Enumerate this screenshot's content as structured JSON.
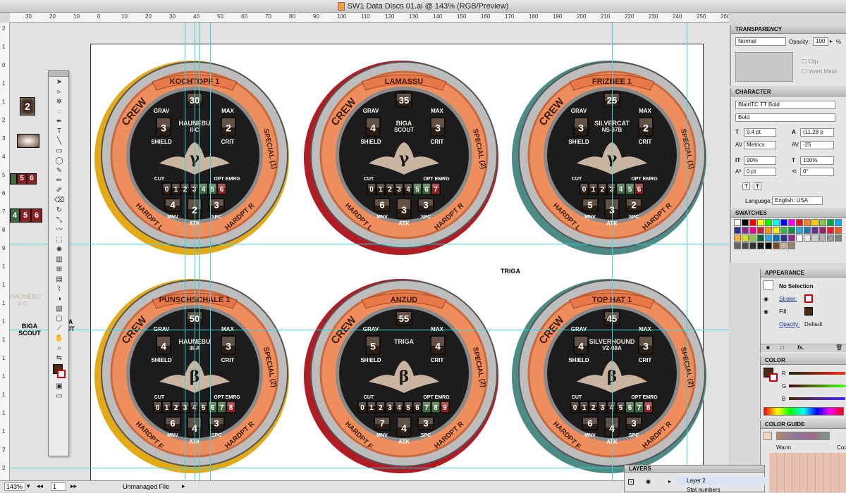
{
  "window": {
    "title": "SW1 Data Discs 01.ai @ 143% (RGB/Preview)"
  },
  "rulers": {
    "h_ticks": [
      "30",
      "20",
      "10",
      "0",
      "10",
      "20",
      "30",
      "40",
      "50",
      "60",
      "70",
      "80",
      "90",
      "100",
      "110",
      "120",
      "130",
      "140",
      "150",
      "160",
      "170",
      "180",
      "190",
      "200",
      "210",
      "220",
      "230",
      "240",
      "250",
      "260",
      "270",
      "280",
      "290",
      "300"
    ],
    "v_ticks": [
      "2",
      "1",
      "0",
      "1",
      "1",
      "2",
      "3",
      "4",
      "5",
      "6",
      "7",
      "8",
      "9",
      "1",
      "1",
      "1",
      "1",
      "1",
      "1",
      "1",
      "1",
      "1",
      "1",
      "2",
      "2"
    ]
  },
  "colors": {
    "yellow_rim": "#e3a917",
    "red_rim": "#b11b24",
    "teal_rim": "#4c8b86",
    "ring_orange": "#ef8e5c",
    "ring_orange_dark": "#c9693d",
    "face": "#1c1c1c",
    "ship": "#c9b49f",
    "guide": "#49d0d8",
    "cell_green": "#3f6a3f",
    "cell_red": "#8a2020"
  },
  "discs": [
    {
      "name": "KOCHTOPF 1",
      "points": "30",
      "grav": "3",
      "max": "2",
      "ship": "HAUNEBU II-C",
      "symbol": "γ",
      "special": "SPECIAL (1)",
      "mnv": "4",
      "atk": "2",
      "spc": "3",
      "rim": "yellow_rim",
      "digits": [
        "0",
        "1",
        "2",
        "3",
        "4",
        "5",
        "6"
      ],
      "hardpt_left": "HARDPT L"
    },
    {
      "name": "LAMASSU",
      "points": "35",
      "grav": "4",
      "max": "3",
      "ship": "BIGA SCOUT",
      "symbol": "γ",
      "special": "SPECIAL (2)",
      "mnv": "6",
      "atk": "3",
      "spc": "3",
      "rim": "red_rim",
      "digits": [
        "0",
        "1",
        "2",
        "3",
        "4",
        "5",
        "6",
        "7"
      ],
      "hardpt_left": "HARDPT L"
    },
    {
      "name": "FRIZBEE 1",
      "points": "25",
      "grav": "3",
      "max": "2",
      "ship": "SILVERCAT NS-97B",
      "symbol": "γ",
      "special": "SPECIAL (1)",
      "mnv": "5",
      "atk": "3",
      "spc": "2",
      "rim": "teal_rim",
      "digits": [
        "0",
        "1",
        "2",
        "3",
        "4",
        "5",
        "6"
      ],
      "hardpt_left": "HARDPT L"
    },
    {
      "name": "PUNSCHSCHALE 1",
      "points": "50",
      "grav": "4",
      "max": "3",
      "ship": "HAUNEBU III-A",
      "symbol": "β",
      "special": "SPECIAL (2)",
      "mnv": "6",
      "atk": "4",
      "spc": "3",
      "rim": "yellow_rim",
      "digits": [
        "0",
        "1",
        "2",
        "3",
        "4",
        "5",
        "6",
        "7",
        "8"
      ],
      "hardpt_left": "HARDPT F"
    },
    {
      "name": "ANZUD",
      "points": "55",
      "grav": "5",
      "max": "4",
      "ship": "TRIGA",
      "symbol": "β",
      "special": "SPECIAL (2)",
      "mnv": "7",
      "atk": "4",
      "spc": "3",
      "rim": "red_rim",
      "digits": [
        "0",
        "1",
        "2",
        "3",
        "4",
        "5",
        "6",
        "7",
        "8",
        "9"
      ],
      "hardpt_left": "HARDPT F"
    },
    {
      "name": "TOP HAT 1",
      "points": "45",
      "grav": "4",
      "max": "3",
      "ship": "SILVERHOUND VZ-08A",
      "symbol": "β",
      "special": "SPECIAL (2)",
      "mnv": "6",
      "atk": "4",
      "spc": "3",
      "rim": "teal_rim",
      "digits": [
        "0",
        "1",
        "2",
        "3",
        "4",
        "5",
        "6",
        "7",
        "8"
      ],
      "hardpt_left": "HARDPT F"
    }
  ],
  "disc_labels": {
    "crew": "CREW",
    "grav": "GRAV",
    "max": "MAX",
    "shield": "SHIELD",
    "crit": "CRIT",
    "cut": "CUT",
    "opt_emrg": "OPT EMRG",
    "mnv": "MNV",
    "atk": "ATK",
    "spc": "SPC",
    "hardpt_r": "HARDPT R"
  },
  "pasteboard": {
    "digit_tile": "2",
    "strip_a": [
      "5",
      "6"
    ],
    "strip_b": [
      "4",
      "5",
      "6"
    ],
    "haunebu": "HAUNEBU II-C",
    "biga_scout": "BIGA SCOUT",
    "a_ut": "A UT",
    "triga": "TRIGA"
  },
  "status": {
    "zoom": "143%",
    "page": "1",
    "file_state": "Unmanaged File"
  },
  "transparency": {
    "title": "TRANSPARENCY",
    "blend_mode": "Normal",
    "opacity_label": "Opacity:",
    "opacity": "100",
    "opacity_unit": "%",
    "clip": "Clip",
    "invert_mask": "Invert Mask"
  },
  "character": {
    "title": "CHARACTER",
    "font_family": "BlairITC TT Bold",
    "font_style": "Bold",
    "size": "9.4 pt",
    "leading": "(11.28 p",
    "kerning": "Metrics",
    "tracking": "-25",
    "vscale": "90%",
    "hscale": "100%",
    "baseline": "0 pt",
    "rotation": "0°",
    "language_label": "Language:",
    "language": "English: USA"
  },
  "swatches": {
    "title": "SWATCHES",
    "colors": [
      "#ffffff",
      "#000000",
      "#ff0000",
      "#ffff00",
      "#00ff00",
      "#00ffff",
      "#0000ff",
      "#ff00ff",
      "#e31a1c",
      "#f58220",
      "#ffcc00",
      "#8cc63f",
      "#00a651",
      "#00aeef",
      "#2e3192",
      "#92278f",
      "#ec008c",
      "#c1272d",
      "#f7941d",
      "#fff200",
      "#39b54a",
      "#009444",
      "#27aae1",
      "#1c75bc",
      "#662d91",
      "#9e1f63",
      "#ed1c24",
      "#f15a24",
      "#fbb03b",
      "#d9e021",
      "#8dc63f",
      "#006837",
      "#29abe2",
      "#0071bc",
      "#2e3192",
      "#93278f",
      "#ffffff",
      "#e6e6e6",
      "#cccccc",
      "#b3b3b3",
      "#999999",
      "#808080",
      "#666666",
      "#4d4d4d",
      "#333333",
      "#1a1a1a",
      "#000000",
      "#754c24",
      "#c7b299",
      "#998675"
    ]
  },
  "appearance": {
    "title": "APPEARANCE",
    "selection": "No Selection",
    "stroke": "Stroke:",
    "fill": "Fill:",
    "opacity": "Opacity:",
    "opacity_value": "Default"
  },
  "color": {
    "title": "COLOR",
    "r": "R",
    "g": "G",
    "b": "B"
  },
  "color_guide": {
    "title": "COLOR GUIDE",
    "warm": "Warm",
    "cool": "Coo"
  },
  "layers": {
    "title": "LAYERS",
    "layer2": "Layer 2",
    "layer_sub": "Stat numbers"
  }
}
